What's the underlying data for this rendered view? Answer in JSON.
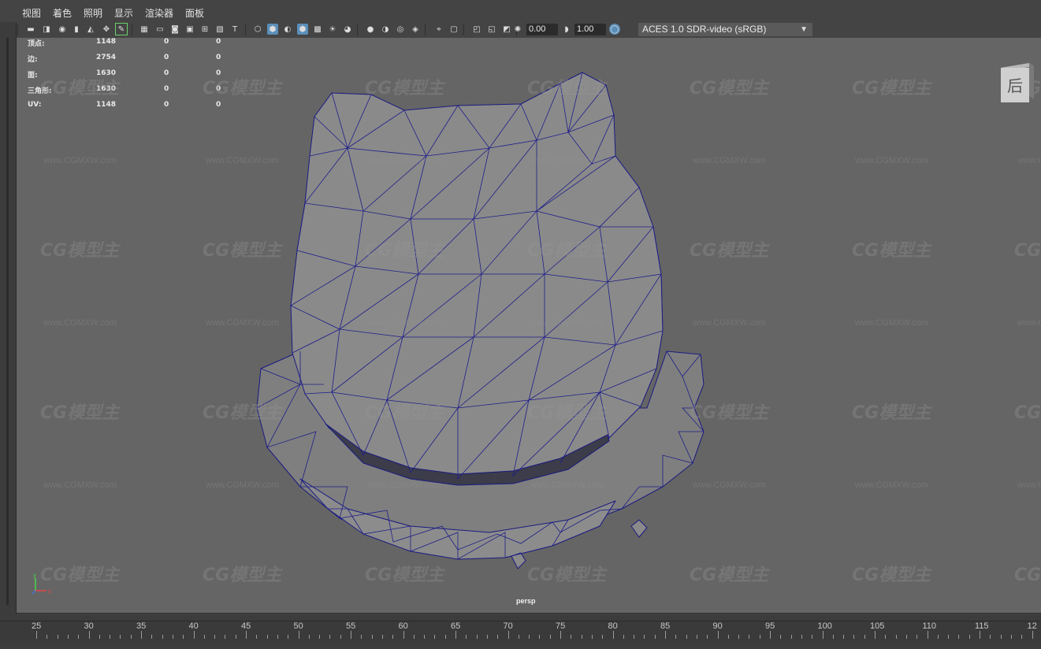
{
  "menu": [
    "视图",
    "着色",
    "照明",
    "显示",
    "渲染器",
    "面板"
  ],
  "toolbar": {
    "exposure_value": "0.00",
    "gamma_value": "1.00",
    "color_space": "ACES 1.0 SDR-video (sRGB)",
    "colors": {
      "active_icon_bg": "#5b8fb9",
      "green_outline": "#6cd06c"
    }
  },
  "hud": {
    "rows": [
      {
        "label": "顶点:",
        "v1": "1148",
        "v2": "0",
        "v3": "0"
      },
      {
        "label": "边:",
        "v1": "2754",
        "v2": "0",
        "v3": "0"
      },
      {
        "label": "面:",
        "v1": "1630",
        "v2": "0",
        "v3": "0"
      },
      {
        "label": "三角形:",
        "v1": "1630",
        "v2": "0",
        "v3": "0"
      },
      {
        "label": "UV:",
        "v1": "1148",
        "v2": "0",
        "v3": "0"
      }
    ]
  },
  "viewport": {
    "camera_label": "persp",
    "view_cube_label": "后",
    "axis_y": "y",
    "axis_x": "x",
    "watermark_logo": "CG模型主",
    "watermark_url": "www.CGMXW.com",
    "colors": {
      "background": "#656565",
      "wire": "#1a1a80",
      "mesh_fill": "#8a8a8a"
    }
  },
  "timeline": {
    "ticks": [
      "25",
      "30",
      "35",
      "40",
      "45",
      "50",
      "55",
      "60",
      "65",
      "70",
      "75",
      "80",
      "85",
      "90",
      "95",
      "100",
      "105",
      "110",
      "115",
      "12"
    ]
  }
}
